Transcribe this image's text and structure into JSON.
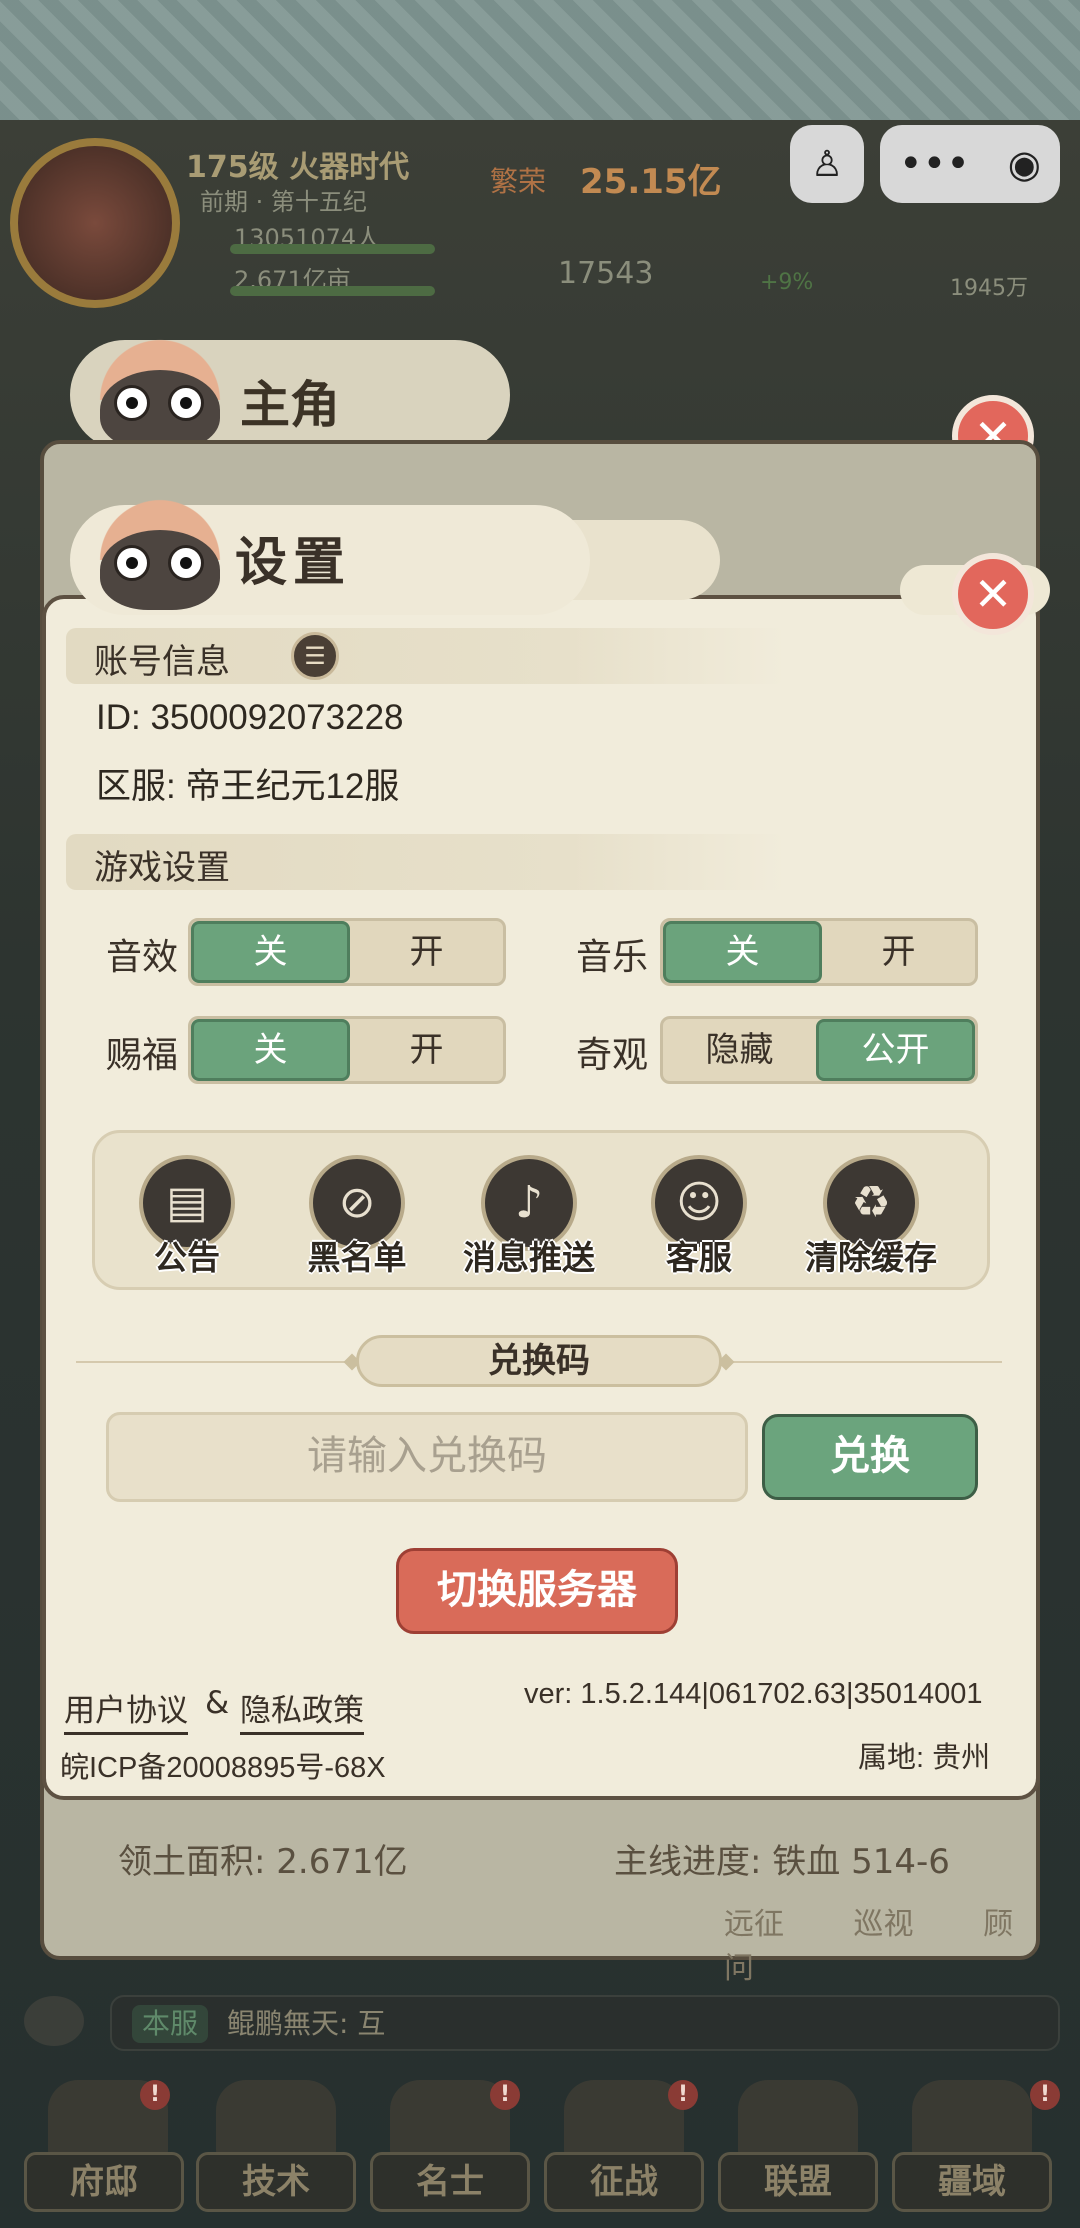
{
  "hud": {
    "level_era": "175级 火器时代",
    "era_stage": "前期 · 第十五纪",
    "population": "13051074人",
    "land": "2.671亿亩",
    "gold": "25.15亿",
    "gold_prefix": "繁荣",
    "food": "17543",
    "growth": "+9%",
    "resource": "1945万"
  },
  "back_panel": {
    "title": "主角",
    "land_area": "领土面积: 2.671亿",
    "main_progress": "主线进度: 铁血 514-6",
    "bottom_links": [
      "远征",
      "巡视",
      "顾问"
    ]
  },
  "dialog": {
    "title": "设置",
    "account_section": "账号信息",
    "id_line": "ID: 3500092073228",
    "server_line": "区服: 帝王纪元12服",
    "game_section": "游戏设置",
    "settings": [
      {
        "label": "音效",
        "options": [
          "关",
          "开"
        ],
        "selected": 0
      },
      {
        "label": "音乐",
        "options": [
          "关",
          "开"
        ],
        "selected": 0
      },
      {
        "label": "赐福",
        "options": [
          "关",
          "开"
        ],
        "selected": 0
      },
      {
        "label": "奇观",
        "options": [
          "隐藏",
          "公开"
        ],
        "selected": 1
      }
    ],
    "icons": [
      {
        "label": "公告",
        "icon": "scroll-icon"
      },
      {
        "label": "黑名单",
        "icon": "blacklist-icon"
      },
      {
        "label": "消息推送",
        "icon": "bell-icon"
      },
      {
        "label": "客服",
        "icon": "customer-service-icon"
      },
      {
        "label": "清除缓存",
        "icon": "trash-icon"
      }
    ],
    "redeem_title": "兑换码",
    "redeem_placeholder": "请输入兑换码",
    "redeem_button": "兑换",
    "switch_server": "切换服务器",
    "user_agreement": "用户协议",
    "amp": "&",
    "privacy_policy": "隐私政策",
    "version": "ver: 1.5.2.144|061702.63|35014001",
    "icp": "皖ICP备20008895号-68X",
    "location": "属地: 贵州"
  },
  "chat": {
    "tag": "本服",
    "text": "鲲鹏無天: 互"
  },
  "nav": [
    "府邸",
    "技术",
    "名士",
    "征战",
    "联盟",
    "疆域"
  ],
  "colors": {
    "toggle_on": "#6ba37c",
    "switch_button": "#d96b59",
    "dialog_bg": "#f1ecdb"
  }
}
